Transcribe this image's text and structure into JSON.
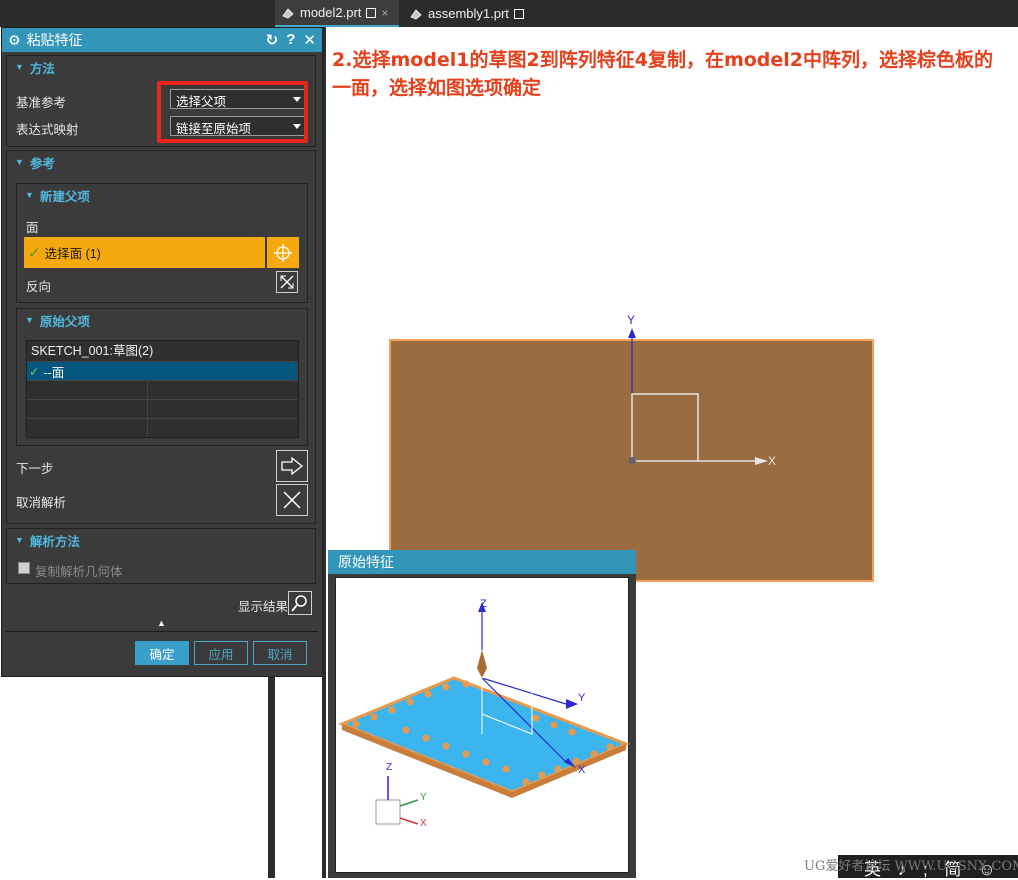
{
  "tabs": [
    {
      "label": "model2.prt",
      "active": true
    },
    {
      "label": "assembly1.prt",
      "active": false
    }
  ],
  "dialog": {
    "title": "粘贴特征",
    "method_group": {
      "header": "方法",
      "ref_label": "基准参考",
      "ref_value": "选择父项",
      "expr_label": "表达式映射",
      "expr_value": "链接至原始项"
    },
    "reference_group": {
      "header": "参考",
      "new_parent": {
        "header": "新建父项",
        "face_label": "面",
        "select_face": "选择面 (1)",
        "reverse_label": "反向"
      },
      "original_parent": {
        "header": "原始父项",
        "table_header": "SKETCH_001:草图(2)",
        "row_label": "--面"
      },
      "next_step": "下一步",
      "cancel_parse": "取消解析"
    },
    "parse_group": {
      "header": "解析方法",
      "copy_geom": "复制解析几何体",
      "show_result": "显示结果"
    },
    "buttons": {
      "ok": "确定",
      "apply": "应用",
      "cancel": "取消"
    }
  },
  "instruction": "2.选择model1的草图2到阵列特征4复制，在model2中阵列，选择棕色板的一面，选择如图选项确定",
  "viewport": {
    "axis_y": "Y",
    "axis_x": "X"
  },
  "popup": {
    "title": "原始特征",
    "axis_z": "Z",
    "axis_y": "Y",
    "axis_x": "X"
  },
  "bottom_bar": "英 ♪ ; 简 ☺",
  "watermark": "UG爱好者论坛 WWW.UGSNX.COM",
  "colors": {
    "accent": "#3396b8",
    "highlight": "#f6a90e",
    "board": "#9a6c3f",
    "instruction": "#e5401c"
  }
}
